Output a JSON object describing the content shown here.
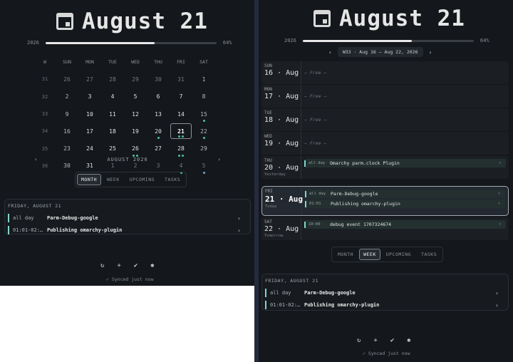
{
  "colors": {
    "accent": "#7fd6c9",
    "dot_teal": "#4fc3a1",
    "dot_blue": "#6fa8dc",
    "bg": "#14171b"
  },
  "left": {
    "header": {
      "icon": "calendar-icon",
      "title": "August 21"
    },
    "progress": {
      "year": "2026",
      "percent_label": "64%",
      "value": 0.64
    },
    "month_grid": {
      "headers": [
        "W",
        "SUN",
        "MON",
        "TUE",
        "WED",
        "THU",
        "FRI",
        "SAT"
      ],
      "weeks": [
        {
          "wk": "31",
          "days": [
            {
              "d": "26",
              "in": false
            },
            {
              "d": "27",
              "in": false
            },
            {
              "d": "28",
              "in": false
            },
            {
              "d": "29",
              "in": false
            },
            {
              "d": "30",
              "in": false
            },
            {
              "d": "31",
              "in": false
            },
            {
              "d": "1",
              "in": true
            }
          ]
        },
        {
          "wk": "32",
          "days": [
            {
              "d": "2",
              "in": true
            },
            {
              "d": "3",
              "in": true
            },
            {
              "d": "4",
              "in": true
            },
            {
              "d": "5",
              "in": true
            },
            {
              "d": "6",
              "in": true
            },
            {
              "d": "7",
              "in": true
            },
            {
              "d": "8",
              "in": true
            }
          ]
        },
        {
          "wk": "33",
          "days": [
            {
              "d": "9",
              "in": true
            },
            {
              "d": "10",
              "in": true
            },
            {
              "d": "11",
              "in": true
            },
            {
              "d": "12",
              "in": true
            },
            {
              "d": "13",
              "in": true
            },
            {
              "d": "14",
              "in": true
            },
            {
              "d": "15",
              "in": true,
              "dots": [
                "teal"
              ]
            }
          ]
        },
        {
          "wk": "34",
          "days": [
            {
              "d": "16",
              "in": true
            },
            {
              "d": "17",
              "in": true
            },
            {
              "d": "18",
              "in": true
            },
            {
              "d": "19",
              "in": true
            },
            {
              "d": "20",
              "in": true,
              "dots": [
                "teal"
              ]
            },
            {
              "d": "21",
              "in": true,
              "today": true,
              "dots": [
                "teal",
                "teal"
              ]
            },
            {
              "d": "22",
              "in": true,
              "dots": [
                "teal"
              ]
            }
          ]
        },
        {
          "wk": "35",
          "days": [
            {
              "d": "23",
              "in": true
            },
            {
              "d": "24",
              "in": true
            },
            {
              "d": "25",
              "in": true
            },
            {
              "d": "26",
              "in": true,
              "dots": [
                "teal",
                "teal"
              ]
            },
            {
              "d": "27",
              "in": true
            },
            {
              "d": "28",
              "in": true,
              "dots": [
                "teal",
                "teal"
              ]
            },
            {
              "d": "29",
              "in": true
            }
          ]
        },
        {
          "wk": "36",
          "days": [
            {
              "d": "30",
              "in": true
            },
            {
              "d": "31",
              "in": true
            },
            {
              "d": "1",
              "in": false
            },
            {
              "d": "2",
              "in": false
            },
            {
              "d": "3",
              "in": false
            },
            {
              "d": "4",
              "in": false,
              "dots": [
                "teal"
              ]
            },
            {
              "d": "5",
              "in": false,
              "dots": [
                "blue"
              ]
            }
          ]
        }
      ]
    },
    "month_nav": {
      "prev": "‹",
      "label": "AUGUST 2026",
      "next": "›"
    },
    "tabs": [
      {
        "label": "MONTH",
        "active": true
      },
      {
        "label": "WEEK",
        "active": false
      },
      {
        "label": "UPCOMING",
        "active": false
      },
      {
        "label": "TASKS",
        "active": false
      }
    ],
    "events": {
      "heading": "FRIDAY, AUGUST 21",
      "items": [
        {
          "time": "all day",
          "name": "Parm-Debug-google",
          "chev": "›"
        },
        {
          "time": "01:01-02:…",
          "name": "Publishing omarchy-plugin",
          "chev": "›"
        }
      ]
    },
    "actions": [
      "↻",
      "+",
      "✔",
      "✱"
    ],
    "synced": "✓ Synced just now"
  },
  "right": {
    "header": {
      "icon": "calendar-icon",
      "title": "August 21"
    },
    "progress": {
      "year": "2026",
      "percent_label": "64%",
      "value": 0.64
    },
    "week_nav": {
      "prev": "‹",
      "label": "W33 · Aug 16 – Aug 22, 2026",
      "next": "›"
    },
    "days": [
      {
        "dow": "SUN",
        "date": "16 · Aug",
        "sub": "",
        "free": "— Free —",
        "events": []
      },
      {
        "dow": "MON",
        "date": "17 · Aug",
        "sub": "",
        "free": "— Free —",
        "events": []
      },
      {
        "dow": "TUE",
        "date": "18 · Aug",
        "sub": "",
        "free": "— Free —",
        "events": []
      },
      {
        "dow": "WED",
        "date": "19 · Aug",
        "sub": "",
        "free": "— Free —",
        "events": []
      },
      {
        "dow": "THU",
        "date": "20 · Aug",
        "sub": "Yesterday",
        "free": "",
        "events": [
          {
            "time": "all day",
            "name": "Omarchy parm.clock Plugin",
            "x": "×"
          }
        ]
      },
      {
        "dow": "FRI",
        "date": "21 · Aug",
        "sub": "Today",
        "free": "",
        "today": true,
        "events": [
          {
            "time": "all day",
            "name": "Parm-Debug-google",
            "x": "×"
          },
          {
            "time": "01:01",
            "name": "Publishing omarchy-plugin",
            "x": "×"
          }
        ]
      },
      {
        "dow": "SAT",
        "date": "22 · Aug",
        "sub": "Tomorrow",
        "free": "",
        "events": [
          {
            "time": "10:00",
            "name": "debug event 1707324674",
            "x": "×"
          }
        ]
      }
    ],
    "tabs": [
      {
        "label": "MONTH",
        "active": false
      },
      {
        "label": "WEEK",
        "active": true
      },
      {
        "label": "UPCOMING",
        "active": false
      },
      {
        "label": "TASKS",
        "active": false
      }
    ],
    "events": {
      "heading": "FRIDAY, AUGUST 21",
      "items": [
        {
          "time": "all day",
          "name": "Parm-Debug-google",
          "chev": "›"
        },
        {
          "time": "01:01-02:…",
          "name": "Publishing omarchy-plugin",
          "chev": "›"
        }
      ]
    },
    "actions": [
      "↻",
      "+",
      "✔",
      "✱"
    ],
    "synced": "✓ Synced just now"
  }
}
